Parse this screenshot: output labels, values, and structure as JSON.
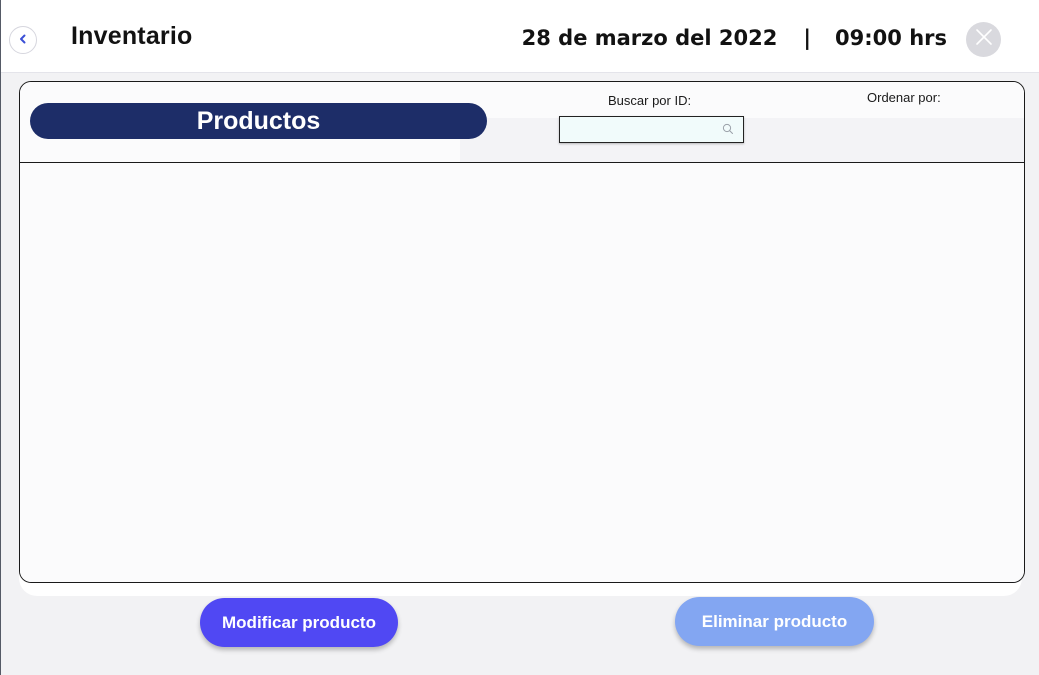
{
  "header": {
    "title": "Inventario",
    "date": "28 de marzo del 2022",
    "separator": "|",
    "time": "09:00 hrs"
  },
  "icons": {
    "back": "chevron-left-icon",
    "close": "close-icon",
    "search": "search-icon"
  },
  "panel": {
    "title": "Productos",
    "search_label": "Buscar por ID:",
    "search_value": "",
    "search_placeholder": "",
    "sort_label": "Ordenar por:",
    "rows": []
  },
  "actions": {
    "modify_label": "Modificar producto",
    "delete_label": "Eliminar producto"
  },
  "colors": {
    "title_pill": "#1d2d68",
    "modify_button": "#5048f3",
    "delete_button": "#83a6f2",
    "back_chevron": "#3a4fd6",
    "search_bg": "#f1fbfb"
  }
}
